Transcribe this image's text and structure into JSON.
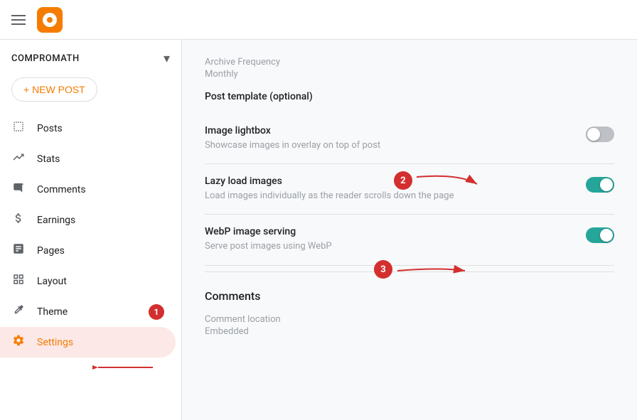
{
  "topbar": {
    "logo_alt": "Blogger logo"
  },
  "sidebar": {
    "blog_name": "COMPROMATH",
    "new_post_label": "+ NEW POST",
    "nav_items": [
      {
        "id": "posts",
        "label": "Posts",
        "icon": "☰"
      },
      {
        "id": "stats",
        "label": "Stats",
        "icon": "📊"
      },
      {
        "id": "comments",
        "label": "Comments",
        "icon": "💬"
      },
      {
        "id": "earnings",
        "label": "Earnings",
        "icon": "$"
      },
      {
        "id": "pages",
        "label": "Pages",
        "icon": "📄"
      },
      {
        "id": "layout",
        "label": "Layout",
        "icon": "⊞"
      },
      {
        "id": "theme",
        "label": "Theme",
        "icon": "🔧",
        "badge": "1"
      },
      {
        "id": "settings",
        "label": "Settings",
        "icon": "⚙",
        "active": true
      }
    ]
  },
  "content": {
    "archive_frequency_label": "Archive Frequency",
    "archive_frequency_value": "Monthly",
    "post_template_label": "Post template (optional)",
    "settings": [
      {
        "id": "image-lightbox",
        "title": "Image lightbox",
        "desc": "Showcase images in overlay on top of post",
        "enabled": false
      },
      {
        "id": "lazy-load",
        "title": "Lazy load images",
        "desc": "Load images individually as the reader scrolls down the page",
        "enabled": true
      },
      {
        "id": "webp",
        "title": "WebP image serving",
        "desc": "Serve post images using WebP",
        "enabled": true
      }
    ],
    "comments_section_title": "Comments",
    "comment_location_label": "Comment location",
    "comment_location_value": "Embedded"
  },
  "annotations": {
    "badge1": "1",
    "badge2": "2",
    "badge3": "3"
  }
}
